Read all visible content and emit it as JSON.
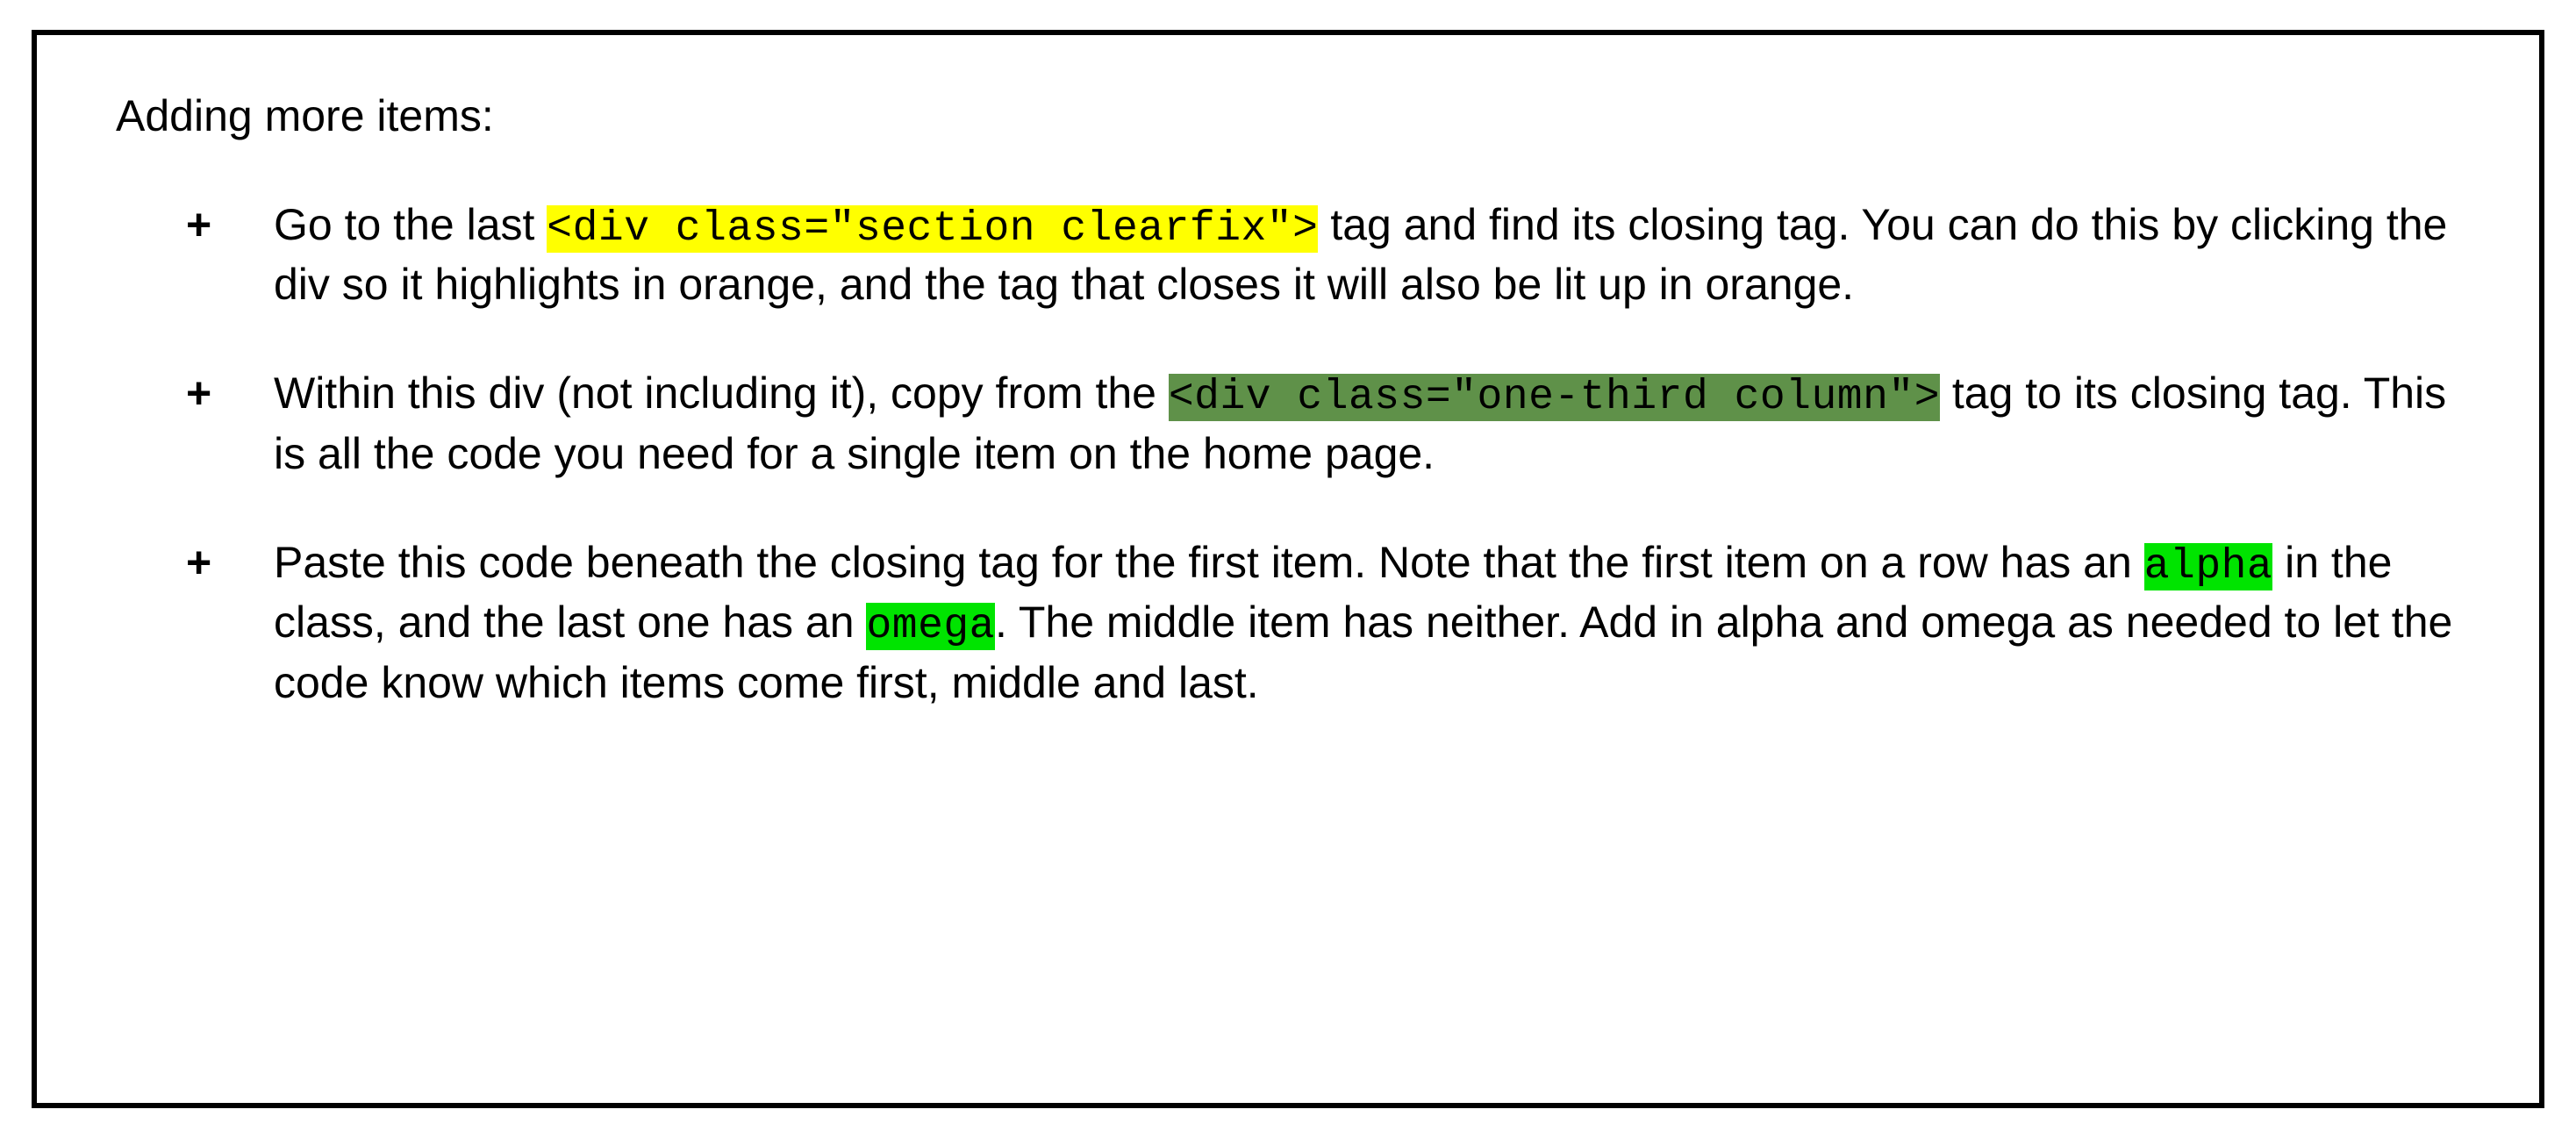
{
  "heading": "Adding more items:",
  "items": [
    {
      "p1a": "Go to the last ",
      "code1": "<div class=\"section clearfix\">",
      "p1b": " tag and find its closing tag. You can do this by clicking the div so it highlights in orange, and the tag that closes it will also be lit up in orange."
    },
    {
      "p2a": "Within this div (not including it), copy from the ",
      "code2": "<div class=\"one-third column\">",
      "p2b": " tag to its closing tag. This is all the code you need for a single item on the home page."
    },
    {
      "p3a": "Paste this code beneath the closing tag for the first item. Note that the first item on a row has an ",
      "code3a": "alpha",
      "p3b": " in the class, and the last one has an ",
      "code3b": "omega",
      "p3c": ". The middle item has neither. Add in alpha and omega as needed to let the code know which items come first, middle and last."
    }
  ]
}
